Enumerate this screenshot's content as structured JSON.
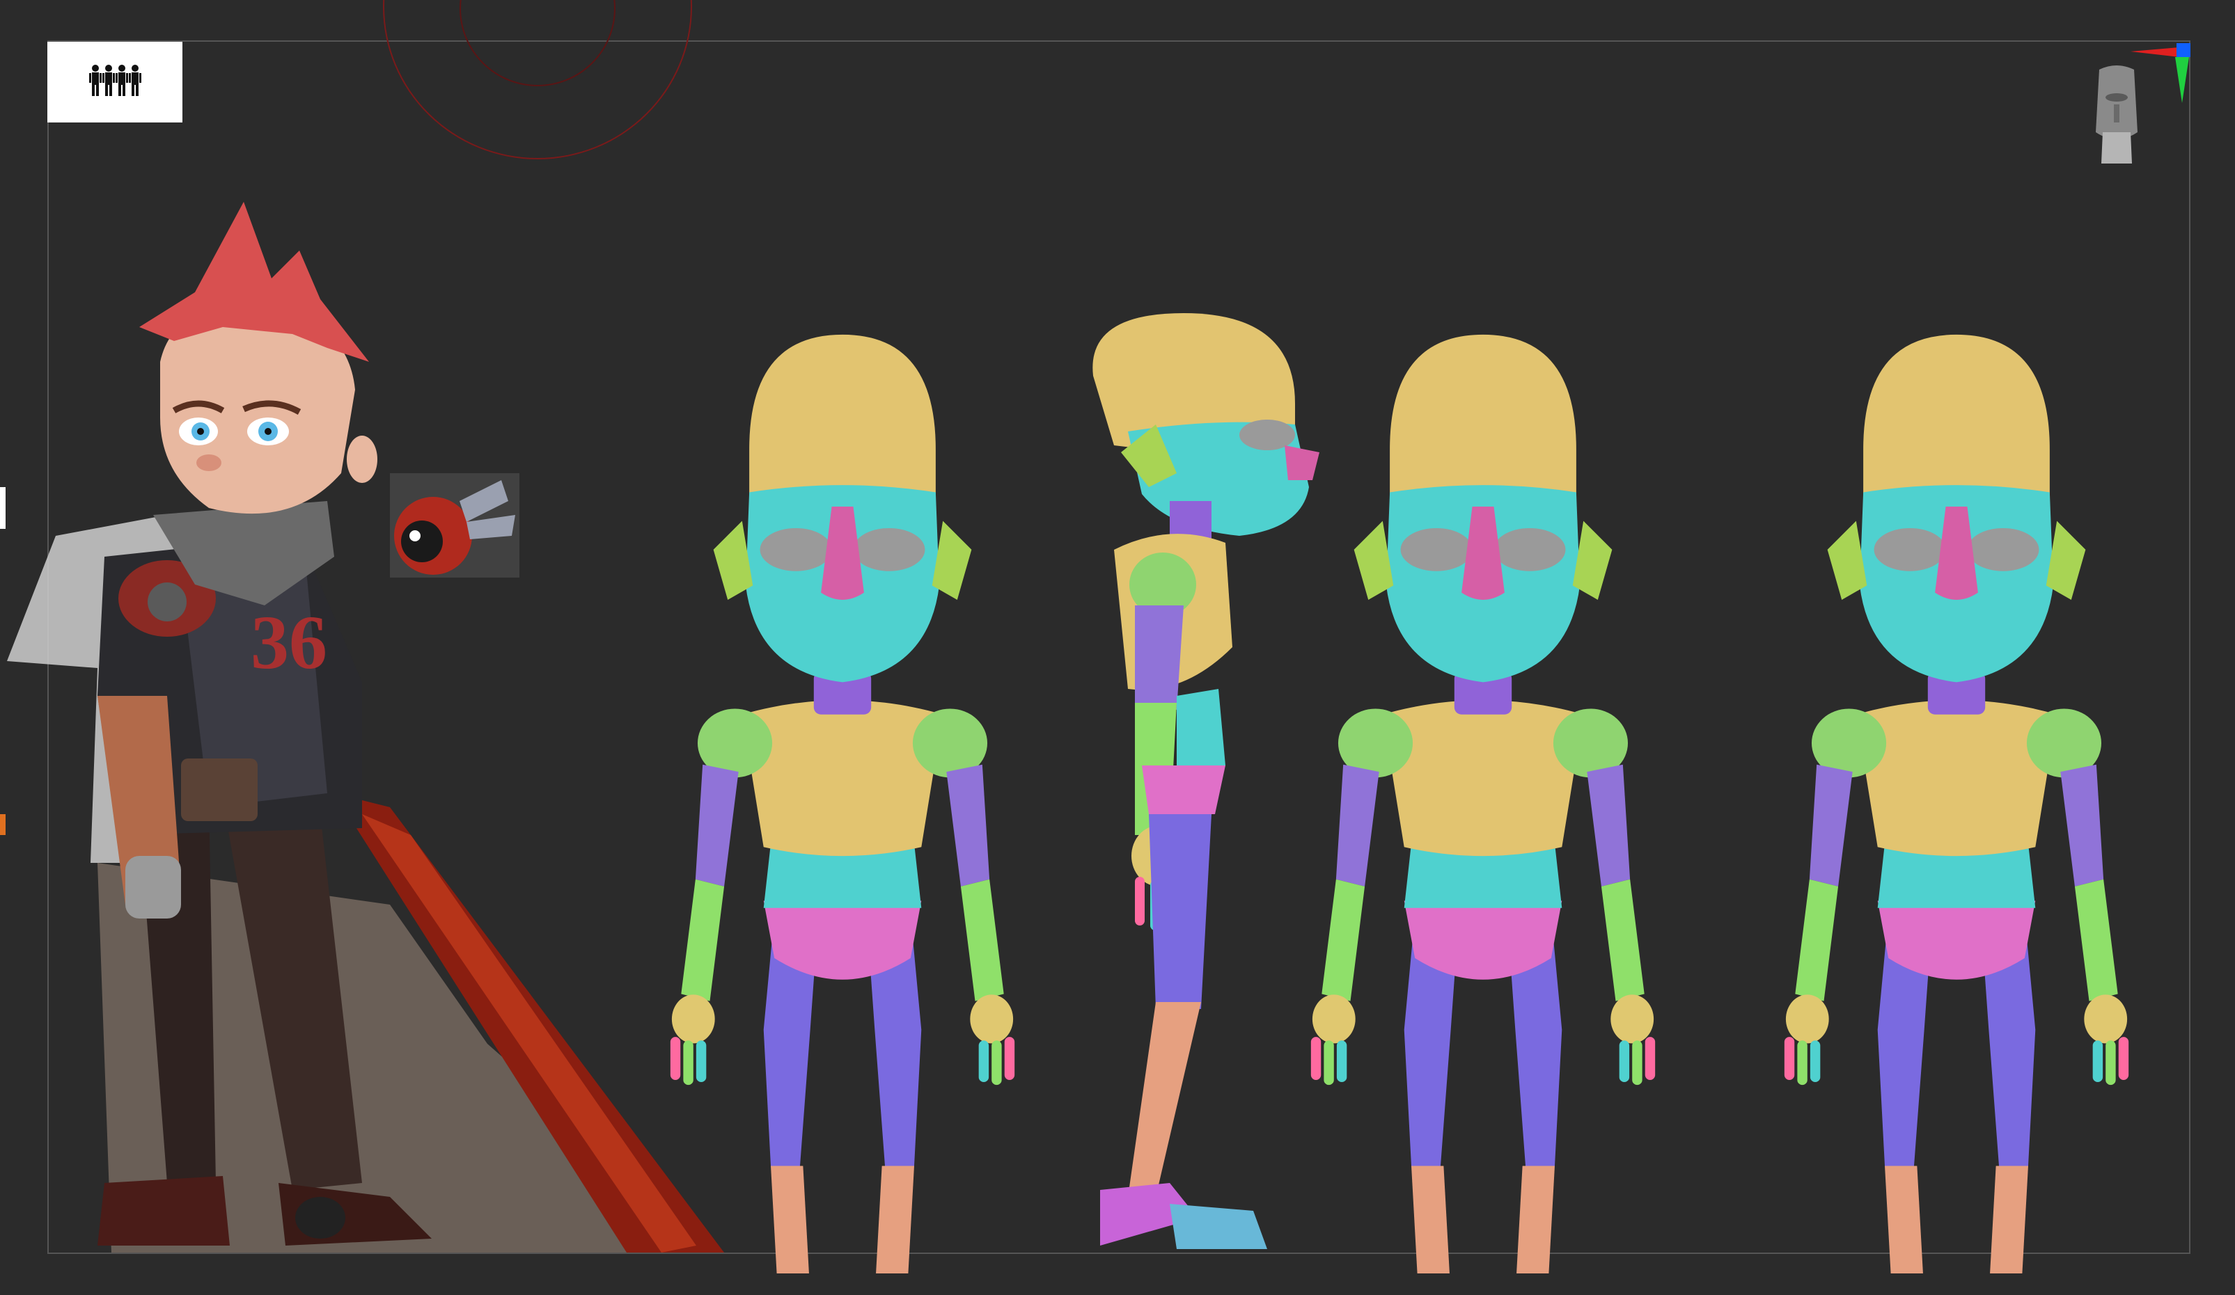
{
  "app": {
    "viewport_name": "zbrush-viewport",
    "thumbnail_button_icon": "reference-figures-icon",
    "navigation_widget_icon": "head-gizmo-icon",
    "axis_colors": {
      "x": "#e02020",
      "y": "#20d040",
      "z": "#1060ff"
    }
  },
  "reference": {
    "sketch_name": "character-concept-sketch",
    "palette": {
      "hair": "#d85050",
      "skin": "#e8b8a0",
      "jacket": "#2a2a2e",
      "scarf": "#6a6a6a",
      "pants": "#2e2220",
      "sword": "#8a1e10",
      "drone_body": "#b02a1e"
    }
  },
  "model": {
    "views": [
      "front",
      "side",
      "back",
      "three-quarter"
    ],
    "polygroup_colors": {
      "head": "#e2c470",
      "face": "#4fd1cf",
      "eye": "#9a9a9a",
      "nose": "#d65fa6",
      "ear": "#a8d454",
      "neck": "#9063d8",
      "chest": "#e2c470",
      "shoulder": "#8fd470",
      "upper_arm": "#9073d8",
      "forearm": "#8fe06a",
      "hand": "#e0c870",
      "belly": "#4fd1cf",
      "hips": "#e070c8",
      "thigh": "#7a6ae0",
      "shin": "#e6a080",
      "sock": "#c864d8",
      "shoe": "#68b8d8",
      "finger_a": "#ff6aa0",
      "finger_b": "#8fe06a",
      "finger_c": "#4fd1cf",
      "finger_d": "#c864d8"
    }
  }
}
